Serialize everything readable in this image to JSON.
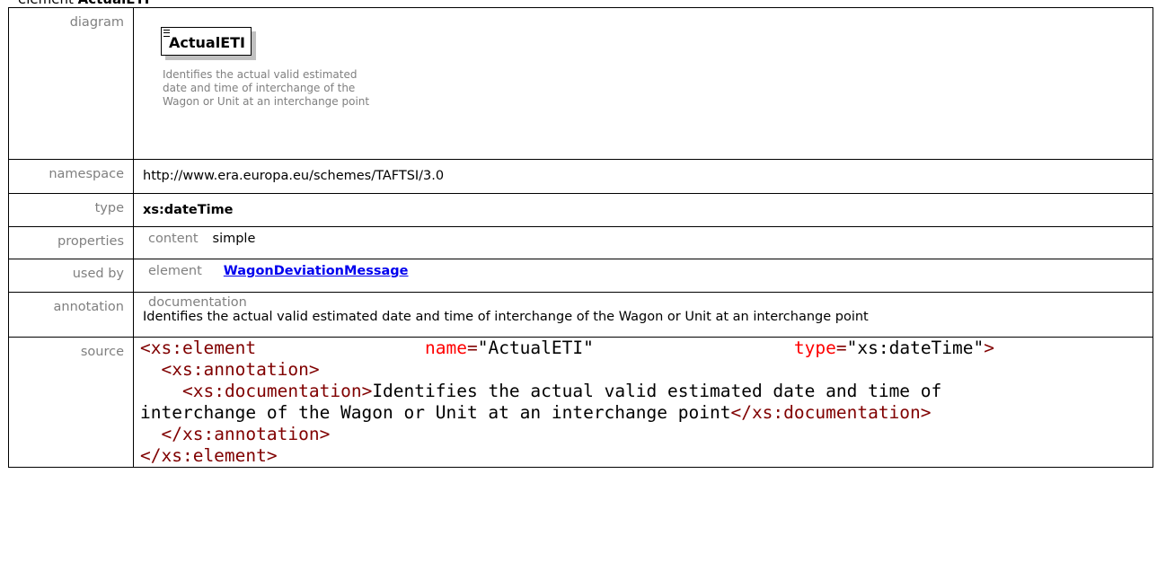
{
  "heading": {
    "prefix": "element ",
    "name": "ActualETI"
  },
  "diagram": {
    "label": "diagram",
    "box_title": "ActualETI",
    "icon": "sequence-lines-icon",
    "doc_text": "Identifies the actual valid estimated date and time of interchange of the Wagon or Unit at an interchange point"
  },
  "namespace": {
    "label": "namespace",
    "value": "http://www.era.europa.eu/schemes/TAFTSI/3.0"
  },
  "type": {
    "label": "type",
    "value": "xs:dateTime"
  },
  "properties": {
    "label": "properties",
    "key": "content",
    "value": "simple"
  },
  "used_by": {
    "label": "used by",
    "kind": "element",
    "link": "WagonDeviationMessage"
  },
  "annotation": {
    "label": "annotation",
    "sub_label": "documentation",
    "text": "Identifies the actual valid estimated date and time of interchange of the Wagon or Unit at an interchange point"
  },
  "source": {
    "label": "source",
    "lt": "<",
    "gt": ">",
    "close_lt": "</",
    "el": "xs:element",
    "name_attr": "name",
    "eq": "=",
    "name_val": "\"ActualETI\"",
    "type_attr": "type",
    "type_val": "\"xs:dateTime\"",
    "annotation_tag": "xs:annotation",
    "doc_tag": "xs:documentation",
    "doc_line1": "Identifies the actual valid estimated date and time of",
    "doc_line2": "interchange of the Wagon or Unit at an interchange point"
  }
}
